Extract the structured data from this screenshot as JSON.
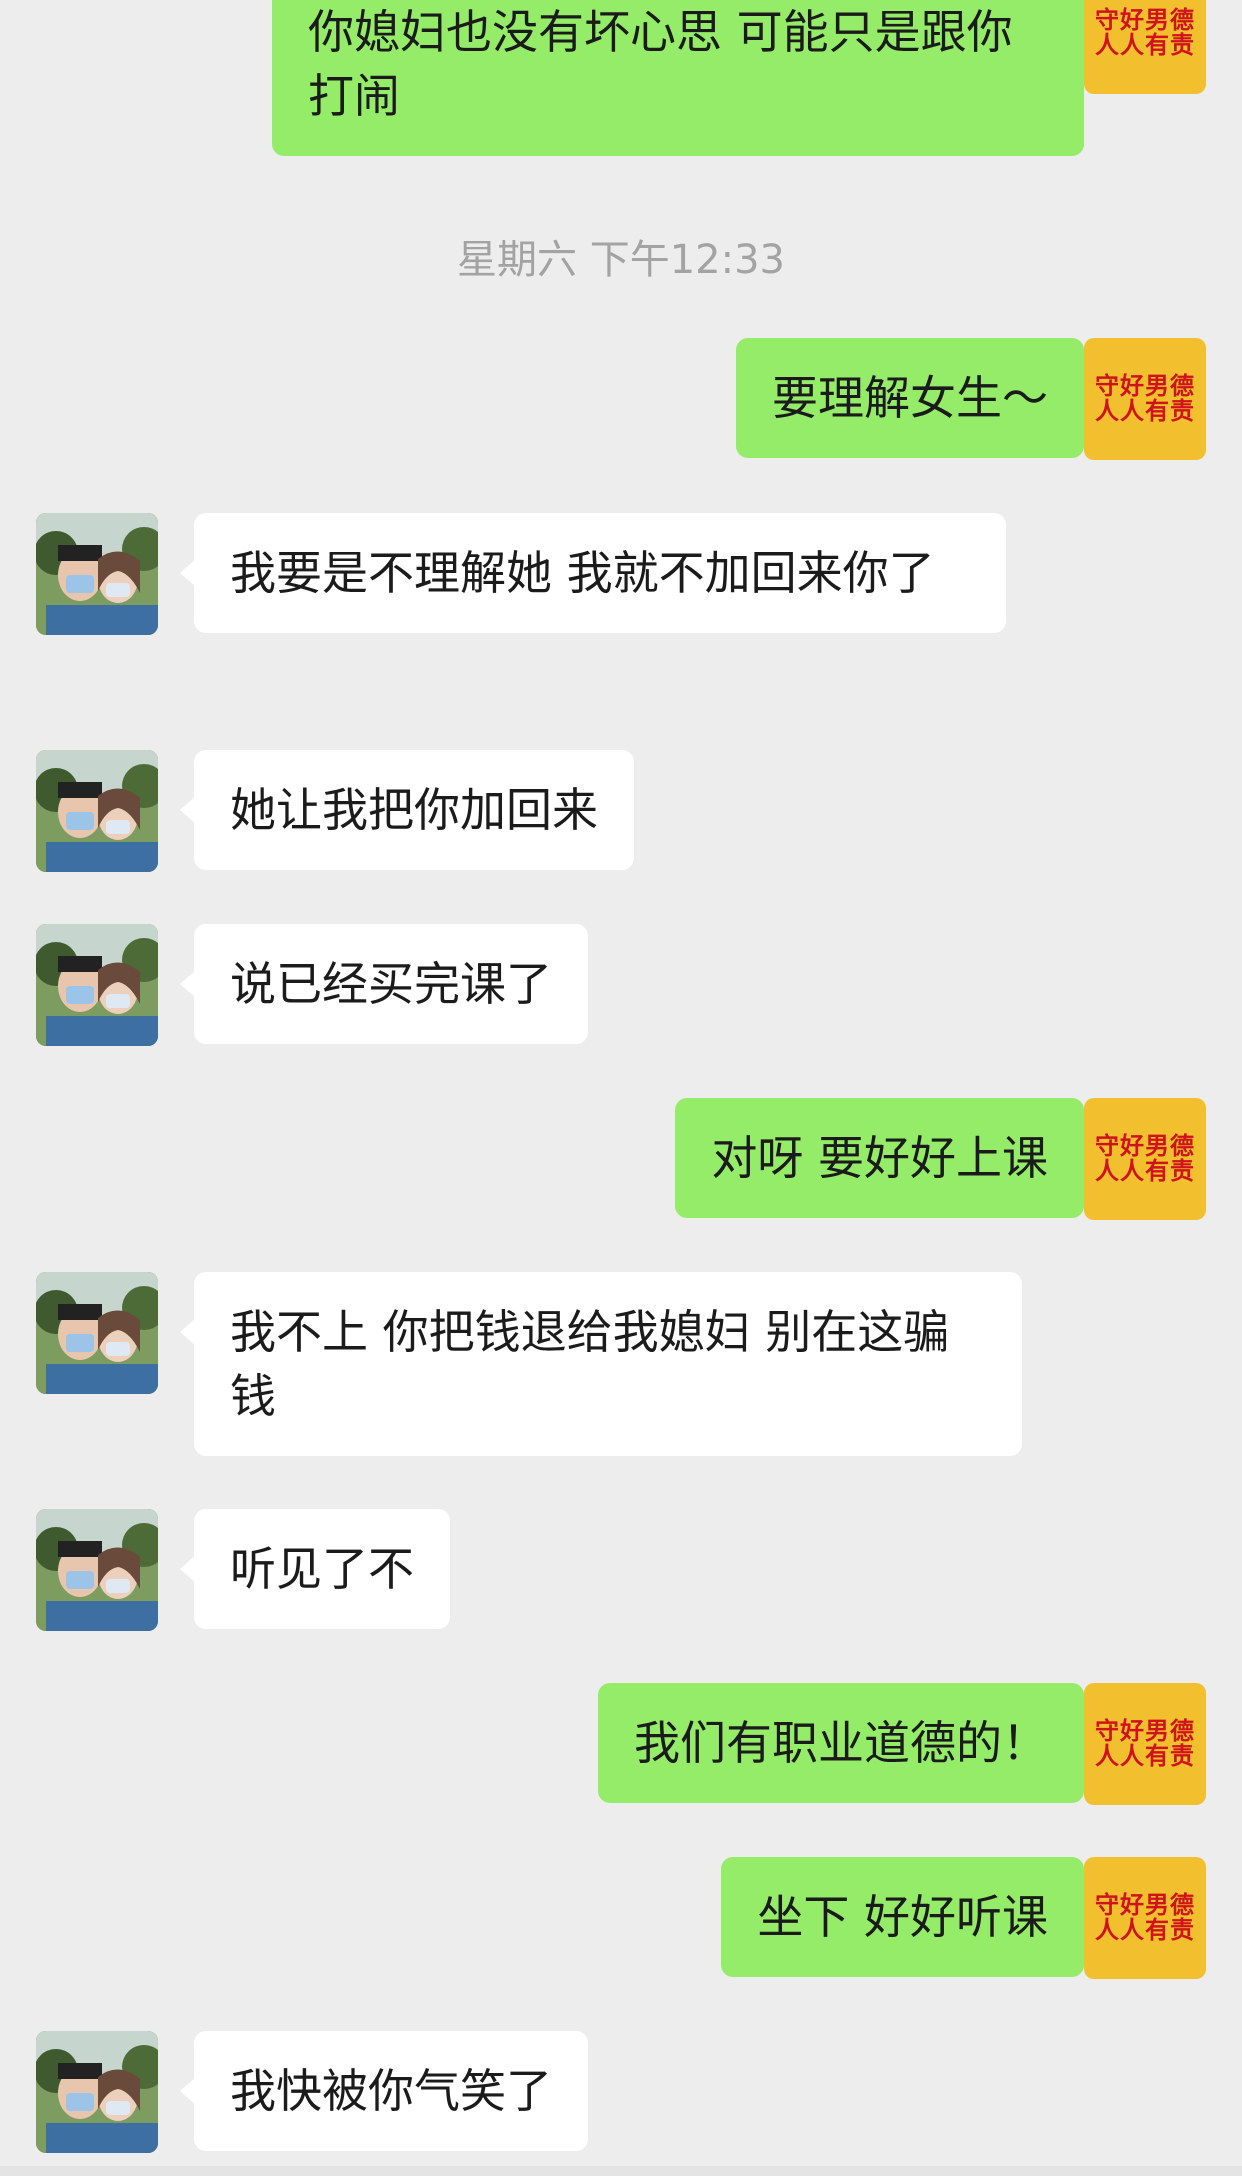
{
  "timestamp": "星期六 下午12:33",
  "avatar_badge": {
    "line1": "守好男德",
    "line2": "人人有责"
  },
  "messages": [
    {
      "side": "out",
      "text": "你媳妇也没有坏心思 可能只是跟你打闹"
    },
    {
      "side": "out",
      "text": "要理解女生～"
    },
    {
      "side": "in",
      "text": "我要是不理解她 我就不加回来你了"
    },
    {
      "side": "in",
      "text": "她让我把你加回来"
    },
    {
      "side": "in",
      "text": "说已经买完课了"
    },
    {
      "side": "out",
      "text": "对呀 要好好上课"
    },
    {
      "side": "in",
      "text": "我不上 你把钱退给我媳妇 别在这骗钱"
    },
    {
      "side": "in",
      "text": "听见了不"
    },
    {
      "side": "out",
      "text": "我们有职业道德的！"
    },
    {
      "side": "out",
      "text": "坐下 好好听课"
    },
    {
      "side": "in",
      "text": "我快被你气笑了"
    }
  ],
  "colors": {
    "background": "#ededed",
    "outgoing_bubble": "#95ec69",
    "incoming_bubble": "#ffffff",
    "badge_bg": "#f2c02f",
    "badge_text": "#d0131a"
  }
}
